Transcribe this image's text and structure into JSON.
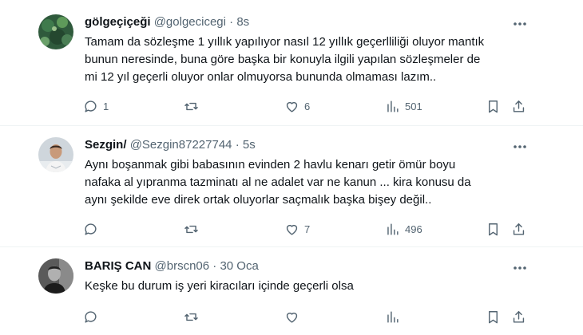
{
  "tweets": [
    {
      "display_name": "gölgeçiçeği",
      "handle": "@golgecicegi",
      "time": "8s",
      "text": "Tamam da sözleşme 1 yıllık yapılıyor nasıl 12 yıllık geçerlliliği oluyor mantık\nbunun neresinde, buna göre başka bir konuyla ilgili yapılan sözleşmeler de\nmi 12 yıl geçerli oluyor onlar olmuyorsa bununda olmaması lazım..",
      "replies": "1",
      "retweets": "",
      "likes": "6",
      "views": "501"
    },
    {
      "display_name": "Sezgin/",
      "handle": "@Sezgin87227744",
      "time": "5s",
      "text": "Aynı boşanmak gibi babasının evinden 2 havlu kenarı getir ömür boyu\nnafaka al yıpranma tazminatı al ne adalet var ne kanun ... kira konusu da\naynı şekilde eve direk ortak oluyorlar saçmalık başka bişey değil..",
      "replies": "",
      "retweets": "",
      "likes": "7",
      "views": "496"
    },
    {
      "display_name": "BARIŞ CAN",
      "handle": "@brscn06",
      "time": "30 Oca",
      "text": "Keşke bu durum iş yeri kiracıları içinde geçerli olsa",
      "replies": "",
      "retweets": "",
      "likes": "",
      "views": ""
    }
  ],
  "separator": "·",
  "icons": {
    "more": "more-horizontal-icon",
    "reply": "reply-icon",
    "retweet": "retweet-icon",
    "like": "heart-icon",
    "views": "views-bar-chart-icon",
    "bookmark": "bookmark-icon",
    "share": "share-icon"
  },
  "colors": {
    "text_primary": "#0f1419",
    "text_secondary": "#536471",
    "divider": "#eff3f4"
  }
}
